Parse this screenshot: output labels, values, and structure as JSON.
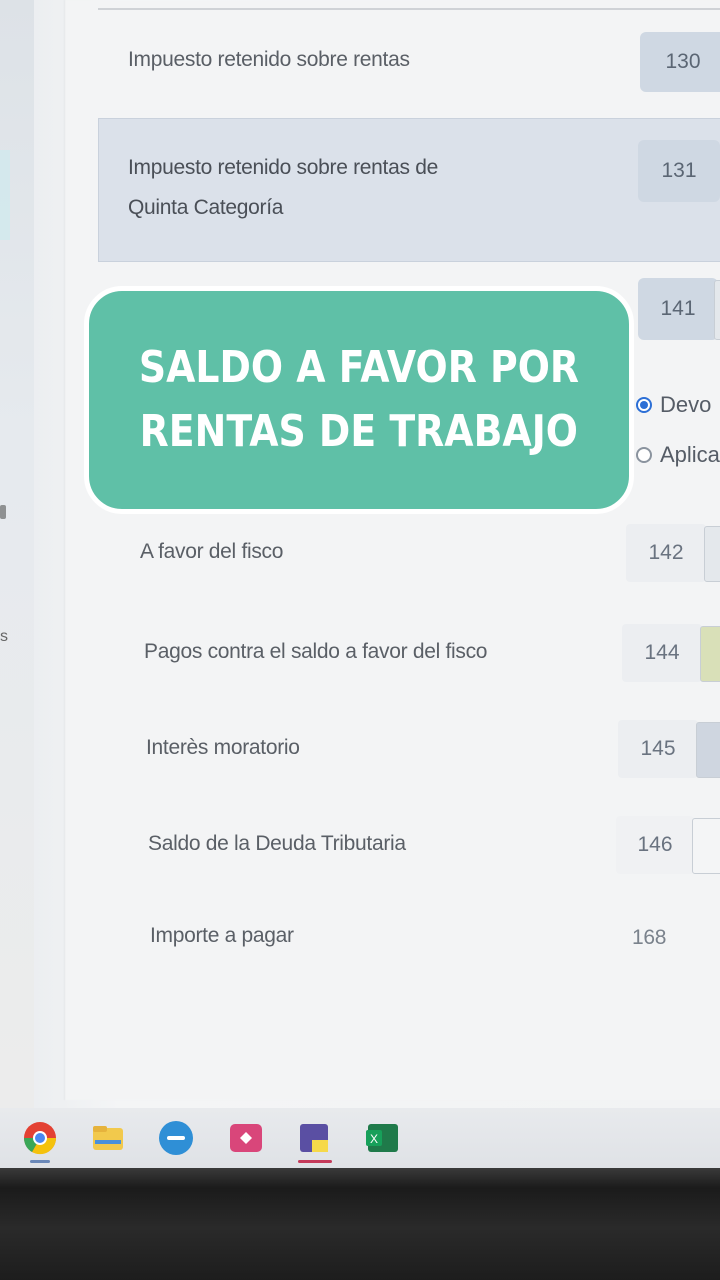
{
  "rows": {
    "r130": {
      "label": "Impuesto retenido sobre rentas",
      "code": "130"
    },
    "r131": {
      "label_line1": "Impuesto retenido sobre rentas de",
      "label_line2": "Quinta Categoría",
      "code": "131"
    },
    "r141": {
      "code": "141"
    },
    "r142": {
      "label": "A favor del fisco",
      "code": "142"
    },
    "r144": {
      "label": "Pagos contra el saldo a favor del fisco",
      "code": "144"
    },
    "r145": {
      "label": "Interès moratorio",
      "code": "145"
    },
    "r146": {
      "label": "Saldo de la Deuda Tributaria",
      "code": "146"
    },
    "r168": {
      "label": "Importe a pagar",
      "code": "168"
    }
  },
  "options": {
    "devolucion": "Devo",
    "aplicacion": "Aplica"
  },
  "overlay": {
    "line1": "SALDO A FAVOR POR",
    "line2": "RENTAS DE TRABAJO"
  },
  "taskbar": {
    "icons": [
      "chrome-icon",
      "file-explorer-icon",
      "meet-icon",
      "app-icon",
      "sticky-notes-icon",
      "excel-icon"
    ]
  },
  "colors": {
    "bubble": "#5fc0a7",
    "highlight_row": "#dbe1ea",
    "radio_selected": "#2c6fd6"
  }
}
